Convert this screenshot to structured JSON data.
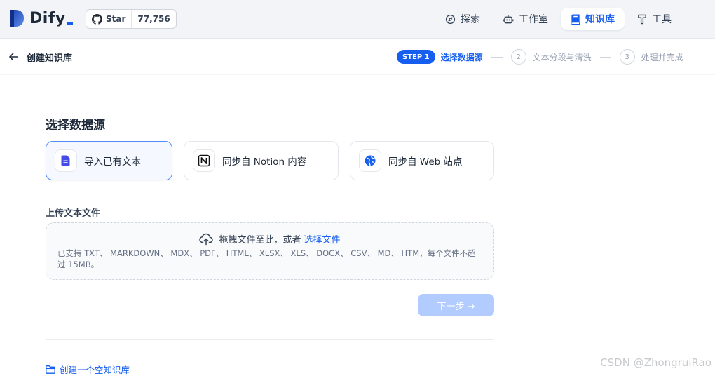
{
  "app": {
    "name": "Dify"
  },
  "github": {
    "star_label": "Star",
    "star_count": "77,756"
  },
  "nav": [
    {
      "label": "探索",
      "icon": "compass-icon",
      "active": false
    },
    {
      "label": "工作室",
      "icon": "robot-icon",
      "active": false
    },
    {
      "label": "知识库",
      "icon": "book-icon",
      "active": true
    },
    {
      "label": "工具",
      "icon": "hammer-icon",
      "active": false
    }
  ],
  "header": {
    "title": "创建知识库"
  },
  "steps": {
    "badge": "STEP 1",
    "current": "选择数据源",
    "step2_num": "2",
    "step2": "文本分段与清洗",
    "step3_num": "3",
    "step3": "处理并完成"
  },
  "main": {
    "section_title": "选择数据源",
    "sources": [
      {
        "label": "导入已有文本",
        "icon": "file-text-icon",
        "selected": true
      },
      {
        "label": "同步自 Notion 内容",
        "icon": "notion-icon",
        "selected": false
      },
      {
        "label": "同步自 Web 站点",
        "icon": "globe-icon",
        "selected": false
      }
    ],
    "upload_title": "上传文本文件",
    "dropzone": {
      "prompt": "拖拽文件至此，或者",
      "link": "选择文件",
      "formats": "已支持 TXT、 MARKDOWN、 MDX、 PDF、 HTML、 XLSX、 XLS、 DOCX、 CSV、 MD、 HTM，每个文件不超过 15MB。"
    },
    "next_button": "下一步 →",
    "empty_kb_link": "创建一个空知识库"
  },
  "watermark": "CSDN @ZhongruiRao",
  "colors": {
    "accent": "#155eef",
    "disabled_button": "#b2ccff",
    "topbar_bg": "#f2f4f7"
  }
}
